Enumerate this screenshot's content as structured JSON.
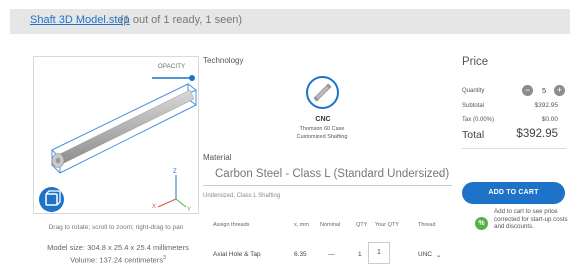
{
  "header": {
    "file_name": "Shaft 3D Model.step",
    "status": "(1 out of 1 ready, 1 seen)"
  },
  "viewer": {
    "opacity_label": "OPACITY",
    "hint": "Drag to rotate; scroll to zoom; right-drag to pan",
    "model_size": "Model size: 304.8 x 25.4 x 25.4 millimeters",
    "volume": "Volume: 137.24 centimeters",
    "volume_sup": "3",
    "axes": {
      "x": "X",
      "y": "Y",
      "z": "Z"
    }
  },
  "technology": {
    "label": "Technology",
    "name": "CNC",
    "sub1": "Thomson 60 Case",
    "sub2": "Customized Shafting",
    "icon": "shaft-icon"
  },
  "material": {
    "label": "Material",
    "selected": "Carbon Steel - Class L (Standard Undersized)",
    "sub": "Undersized, Class L Shafting"
  },
  "threads": {
    "headers": [
      "Assign threads",
      "x, mm",
      "Nominal",
      "QTY",
      "Your QTY",
      "Thread"
    ],
    "row": {
      "name": "Axial Hole & Tap",
      "x": "6.35",
      "nominal": "—",
      "qty": "1",
      "your_qty": "1",
      "thread": "UNC"
    }
  },
  "price": {
    "title": "Price",
    "quantity_label": "Quantity",
    "quantity": "5",
    "minus": "−",
    "plus": "+",
    "subtotal_label": "Subtotal",
    "subtotal": "$392.95",
    "tax_label": "Tax (0.00%)",
    "tax": "$0.00",
    "total_label": "Total",
    "total": "$392.95",
    "add_to_cart": "ADD TO CART",
    "promo_text": "Add to cart to see price corrected for start-up costs and discounts.",
    "promo_icon": "%"
  },
  "colors": {
    "accent": "#1e73c8",
    "promo": "#56b045"
  }
}
